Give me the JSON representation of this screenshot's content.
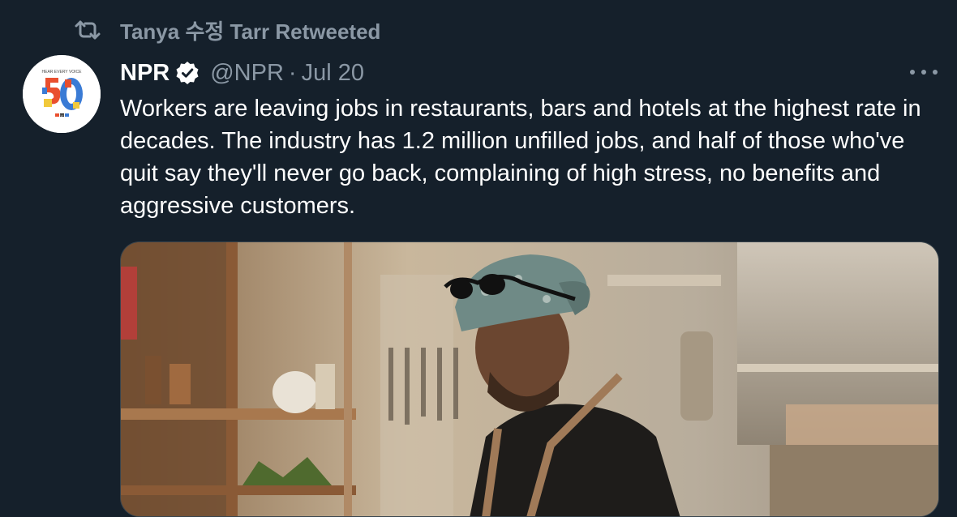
{
  "retweet": {
    "icon": "retweet-icon",
    "text": "Tanya 수정 Tarr Retweeted"
  },
  "author": {
    "avatar_text": "HEAR EVERY VOICE",
    "avatar_badge": "npr",
    "name": "NPR",
    "verified": true,
    "handle": "@NPR",
    "separator": "·",
    "date": "Jul 20"
  },
  "tweet": {
    "text": "Workers are leaving jobs in restaurants, bars and hotels at the highest rate in decades. The industry has 1.2 million unfilled jobs, and half of those who've quit say they'll never go back, complaining of high stress, no benefits and aggressive customers."
  },
  "colors": {
    "background": "#15202b",
    "secondary_text": "#8b98a5",
    "verified_badge": "#ffffff"
  }
}
